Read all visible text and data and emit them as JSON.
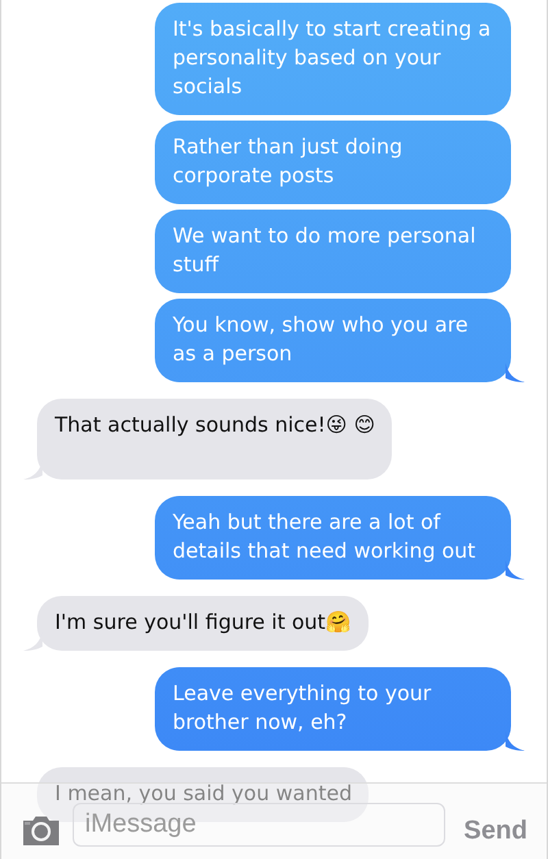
{
  "messages": [
    {
      "kind": "sent",
      "text": "It's basically to start creating a personality based on your socials",
      "tail": false
    },
    {
      "kind": "sent",
      "text": "Rather than just doing corporate posts",
      "tail": false
    },
    {
      "kind": "sent",
      "text": "We want to do more personal stuff",
      "tail": false
    },
    {
      "kind": "sent",
      "text": "You know, show who you are as a person",
      "tail": true
    },
    {
      "kind": "received",
      "text": "That actually sounds nice!😜 😊",
      "tail": true
    },
    {
      "kind": "sent",
      "text": "Yeah but there are a lot of details that need working out",
      "tail": true
    },
    {
      "kind": "received",
      "text": "I'm sure you'll figure it out🤗",
      "tail": true
    },
    {
      "kind": "sent",
      "text": "Leave everything to your brother now, eh?",
      "tail": true
    },
    {
      "kind": "received",
      "text": "I mean, you said you wanted"
    }
  ],
  "composer": {
    "placeholder": "iMessage",
    "send": "Send"
  }
}
